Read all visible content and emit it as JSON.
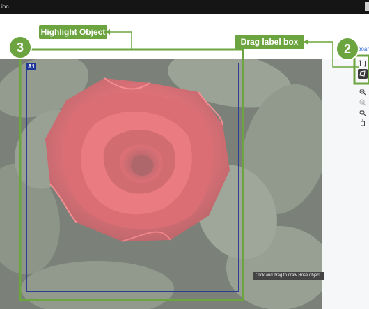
{
  "app": {
    "title_fragment": "ion"
  },
  "panel": {
    "link_fragment": "board"
  },
  "label_box": {
    "tag": "A1"
  },
  "tooltip": {
    "text": "Click and drag to draw Rose object."
  },
  "annotations": {
    "highlight_object": "Highlight Object",
    "drag_label_box": "Drag label box",
    "step_2": "2",
    "step_3": "3",
    "accent_color": "#6ca53f"
  },
  "toolbar": {
    "tools": [
      {
        "icon": "bounding-box-icon",
        "selected": false
      },
      {
        "icon": "polygon-icon",
        "selected": true
      },
      {
        "icon": "zoom-in-icon",
        "selected": false
      },
      {
        "icon": "zoom-out-icon",
        "selected": false
      },
      {
        "icon": "zoom-fit-icon",
        "selected": false
      },
      {
        "icon": "delete-icon",
        "selected": false
      }
    ]
  },
  "colors": {
    "label_box_border": "#2a3f8f",
    "label_tag_bg": "#1d3596",
    "topbar_bg": "#151515"
  }
}
